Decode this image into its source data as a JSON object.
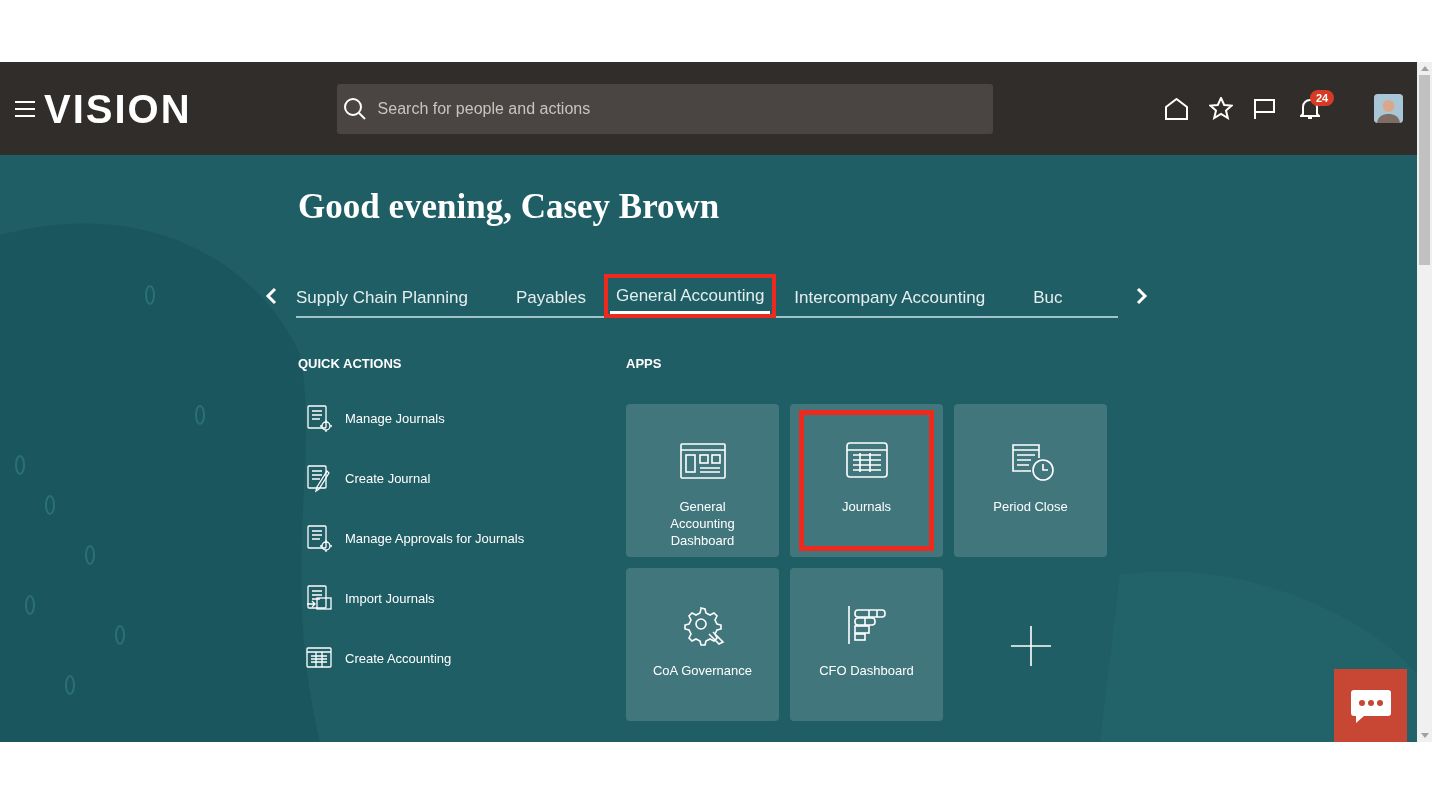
{
  "header": {
    "logo": "VISION",
    "search": {
      "placeholder": "Search for people and actions"
    },
    "notifications": {
      "count": "24"
    }
  },
  "greeting": "Good evening, Casey Brown",
  "tabs": [
    {
      "label": "Supply Chain Planning",
      "selected": false,
      "highlighted": false
    },
    {
      "label": "Payables",
      "selected": false,
      "highlighted": false
    },
    {
      "label": "General Accounting",
      "selected": true,
      "highlighted": true
    },
    {
      "label": "Intercompany Accounting",
      "selected": false,
      "highlighted": false
    },
    {
      "label": "Buc",
      "selected": false,
      "highlighted": false
    }
  ],
  "quick_actions": {
    "title": "QUICK ACTIONS",
    "items": [
      {
        "label": "Manage Journals",
        "kind": "gear"
      },
      {
        "label": "Create Journal",
        "kind": "edit"
      },
      {
        "label": "Manage Approvals for Journals",
        "kind": "gear"
      },
      {
        "label": "Import Journals",
        "kind": "import"
      },
      {
        "label": "Create Accounting",
        "kind": "table"
      }
    ]
  },
  "apps": {
    "title": "APPS",
    "items": [
      {
        "label": "General Accounting Dashboard",
        "kind": "dashboard",
        "highlighted": false
      },
      {
        "label": "Journals",
        "kind": "table",
        "highlighted": true
      },
      {
        "label": "Period Close",
        "kind": "clock",
        "highlighted": false
      },
      {
        "label": "CoA Governance",
        "kind": "gear",
        "highlighted": false
      },
      {
        "label": "CFO Dashboard",
        "kind": "bars",
        "highlighted": false
      },
      {
        "kind": "add",
        "highlighted": false
      }
    ]
  }
}
